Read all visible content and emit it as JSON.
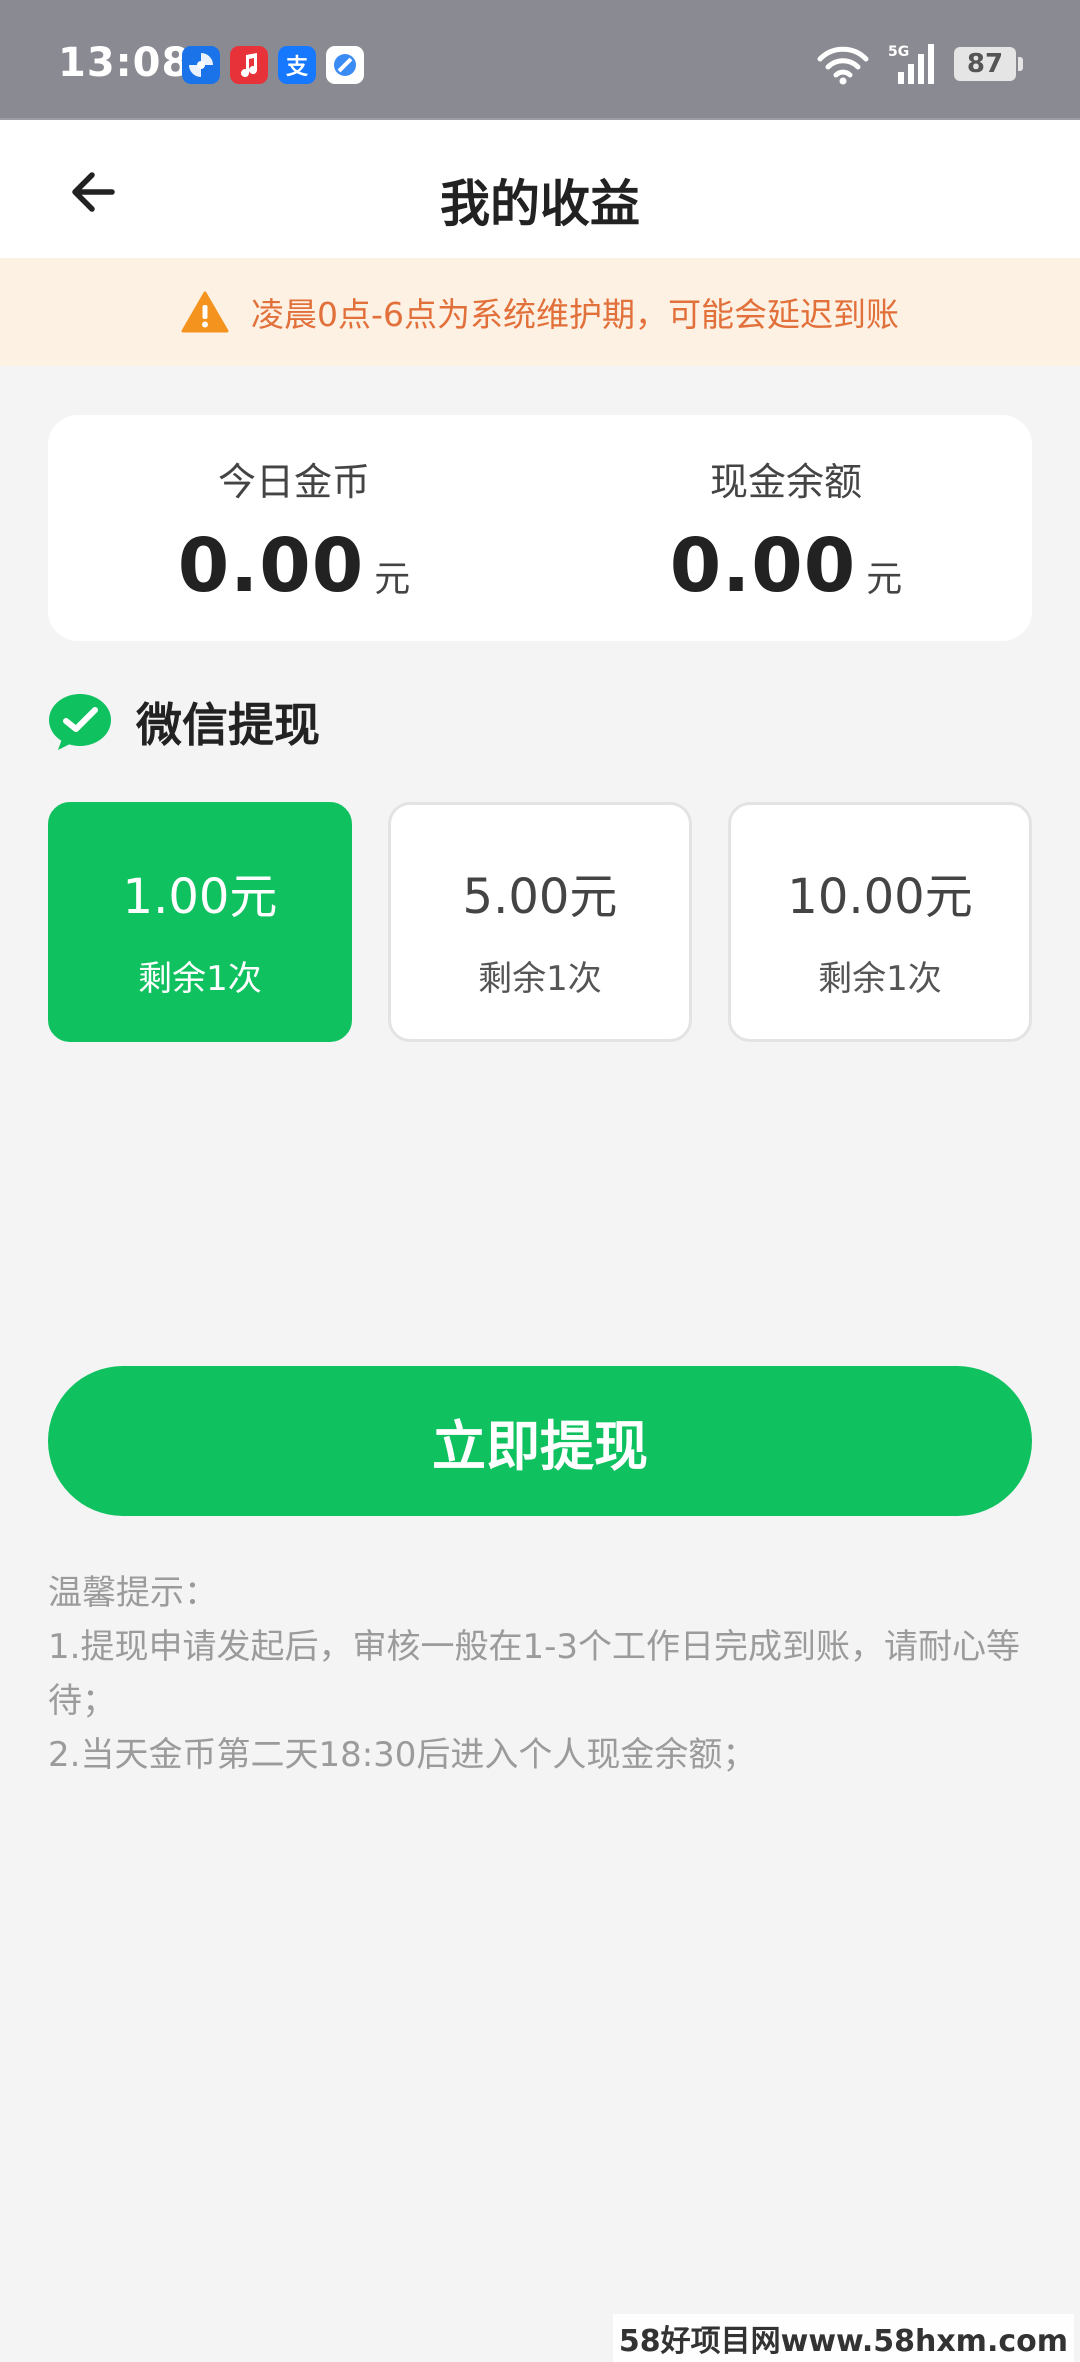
{
  "status_bar": {
    "time": "13:08",
    "battery": "87",
    "app_icons": [
      {
        "name": "pinwheel-app-icon",
        "color": "#1a73e8"
      },
      {
        "name": "music-app-icon",
        "color": "#e8323a"
      },
      {
        "name": "alipay-app-icon",
        "color": "#1677ff",
        "glyph": "支"
      },
      {
        "name": "browser-app-icon",
        "color": "#3b8bf5"
      }
    ]
  },
  "header": {
    "title": "我的收益"
  },
  "notice": {
    "text": "凌晨0点-6点为系统维护期，可能会延迟到账",
    "icon": "warning-icon",
    "color": "#e2703a"
  },
  "balance": {
    "today_coins_label": "今日金币",
    "today_coins_value": "0.00",
    "today_coins_unit": "元",
    "cash_balance_label": "现金余额",
    "cash_balance_value": "0.00",
    "cash_balance_unit": "元"
  },
  "withdraw_method": {
    "label": "微信提现",
    "icon": "wechat-icon"
  },
  "options": [
    {
      "amount": "1.00元",
      "remaining": "剩余1次",
      "selected": true
    },
    {
      "amount": "5.00元",
      "remaining": "剩余1次",
      "selected": false
    },
    {
      "amount": "10.00元",
      "remaining": "剩余1次",
      "selected": false
    }
  ],
  "actions": {
    "withdraw_label": "立即提现"
  },
  "tips": {
    "title": "温馨提示：",
    "line1": "1.提现申请发起后，审核一般在1-3个工作日完成到账，请耐心等待；",
    "line2": "2.当天金币第二天18:30后进入个人现金余额；"
  },
  "watermark": "58好项目网www.58hxm.com",
  "colors": {
    "accent": "#0fc15f",
    "notice_bg": "#fdf1e3",
    "background": "#f4f4f4"
  }
}
